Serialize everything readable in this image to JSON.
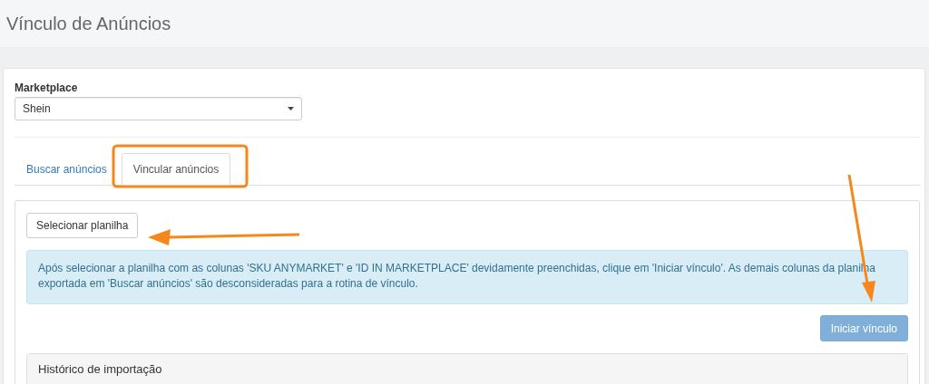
{
  "page": {
    "title": "Vínculo de Anúncios"
  },
  "marketplace": {
    "label": "Marketplace",
    "value": "Shein"
  },
  "tabs": [
    {
      "label": "Buscar anúncios",
      "selected": false
    },
    {
      "label": "Vincular anúncios",
      "selected": true
    }
  ],
  "select_button": "Selecionar planilha",
  "alert": "Após selecionar a planilha com as colunas 'SKU ANYMARKET' e 'ID IN MARKETPLACE' devidamente preenchidas, clique em 'Iniciar vínculo'. As demais colunas da planilha exportada em 'Buscar anúncios' são desconsideradas para a rotina de vínculo.",
  "start_button": {
    "label": "Iniciar vínculo",
    "disabled": true
  },
  "history_panel": {
    "title": "Histórico de importação"
  }
}
